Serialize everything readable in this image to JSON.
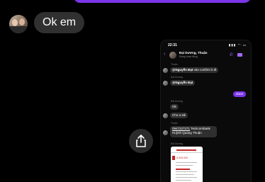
{
  "chat": {
    "incoming_message": "Ok em"
  },
  "shared_screenshot": {
    "status_time": "22:31",
    "status_signal": "▮▮▮ ◠ ▭",
    "contact_name": "Đại Dương, Thuận",
    "contact_status": "Đang hoạt động",
    "messages": [
      {
        "sender": "Thuận",
        "mention": "@Nguyễn Đạt",
        "text": "vào confirm b đi"
      },
      {
        "sender": "Đại Dương",
        "mention": "@Nguyễn Đạt",
        "text": ""
      },
      {
        "sender": "",
        "text": "done",
        "mine": true
      },
      {
        "sender": "Đại Dương",
        "text": "Ok"
      },
      {
        "sender": "",
        "text": "Cho a stk"
      },
      {
        "sender": "Thuận",
        "link": "0947227271",
        "text": "Teckcombank Huỳnh Quang Thuận"
      },
      {
        "sender": "Đại Dương",
        "text": ""
      }
    ],
    "receipt_amount": "-4.000.000"
  },
  "icons": {
    "share": "share-icon",
    "call": "phone-icon",
    "video": "video-icon",
    "back": "back-chevron-icon"
  },
  "colors": {
    "accent": "#7b35e8",
    "bubble": "#303030",
    "background": "#000000"
  }
}
